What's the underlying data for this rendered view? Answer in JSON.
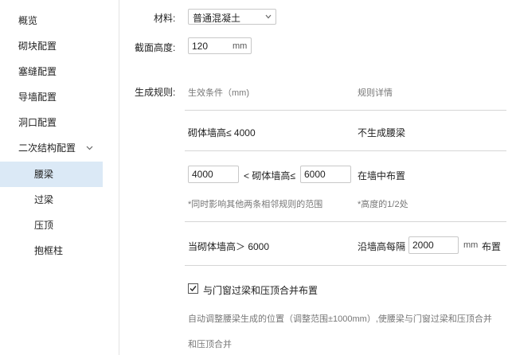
{
  "sidebar": {
    "items": [
      {
        "label": "概览"
      },
      {
        "label": "砌块配置"
      },
      {
        "label": "塞缝配置"
      },
      {
        "label": "导墙配置"
      },
      {
        "label": "洞口配置"
      },
      {
        "label": "二次结构配置"
      }
    ],
    "subitems": [
      {
        "label": "腰梁"
      },
      {
        "label": "过梁"
      },
      {
        "label": "压顶"
      },
      {
        "label": "抱框柱"
      }
    ]
  },
  "form": {
    "material_label": "材料:",
    "material_value": "普通混凝土",
    "section_height_label": "截面高度:",
    "section_height_value": "120",
    "section_height_unit": "mm",
    "rules_label": "生成规则:",
    "col_condition": "生效条件（mm)",
    "col_detail": "规则详情",
    "rule1_condition": "砌体墙高≤ 4000",
    "rule1_detail": "不生成腰梁",
    "rule2_min": "4000",
    "rule2_mid": "< 砌体墙高≤",
    "rule2_max": "6000",
    "rule2_detail": "在墙中布置",
    "rule2_note": "*同时影响其他两条相邻规则的范围",
    "rule2_detail_note": "*高度的1/2处",
    "rule3_condition": "当砌体墙高＞ 6000",
    "rule3_detail_prefix": "沿墙高每隔",
    "rule3_interval": "2000",
    "rule3_unit": "mm",
    "rule3_suffix": "布置",
    "merge_checked": true,
    "merge_label": "与门窗过梁和压顶合并布置",
    "merge_desc_line1": "自动调整腰梁生成的位置（调整范围±1000mm）,使腰梁与门窗过梁和压顶合并",
    "merge_desc_line2": "和压顶合并"
  }
}
